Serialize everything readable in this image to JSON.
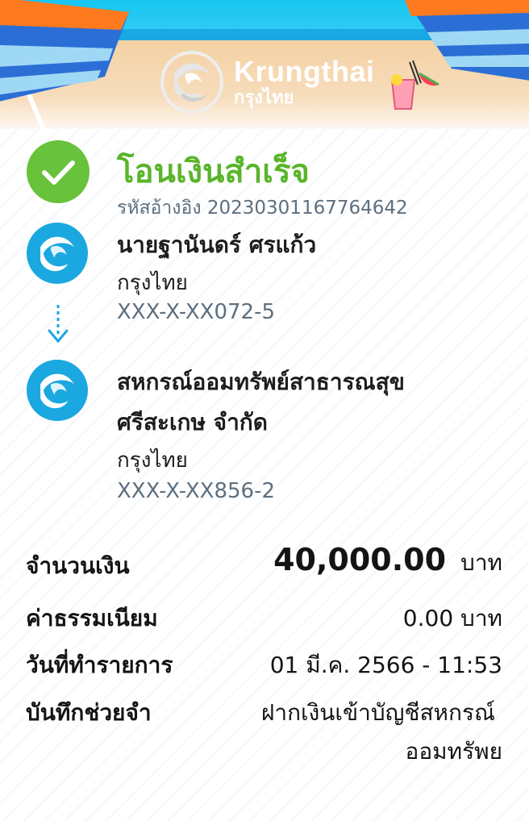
{
  "header": {
    "brand_en": "Krungthai",
    "brand_th": "กรุงไทย"
  },
  "status": {
    "title": "โอนเงินสำเร็จ",
    "reference_label": "รหัสอ้างอิง",
    "reference_number": "20230301167764642",
    "color": "#5ab52a"
  },
  "sender": {
    "name": "นายฐานันดร์ ศรแก้ว",
    "bank": "กรุงไทย",
    "account": "XXX-X-XX072-5"
  },
  "receiver": {
    "name_line1": "สหกรณ์ออมทรัพย์สาธารณสุข",
    "name_line2": "ศรีสะเกษ จำกัด",
    "bank": "กรุงไทย",
    "account": "XXX-X-XX856-2"
  },
  "details": {
    "amount_label": "จำนวนเงิน",
    "amount_value": "40,000.00",
    "amount_unit": "บาท",
    "fee_label": "ค่าธรรมเนียม",
    "fee_value": "0.00 บาท",
    "date_label": "วันที่ทำรายการ",
    "date_value": "01 มี.ค. 2566 - 11:53",
    "memo_label": "บันทึกช่วยจำ",
    "memo_line1": "ฝากเงินเข้าบัญชีสหกรณ์",
    "memo_line2": "ออมทรัพย"
  },
  "colors": {
    "brand_blue": "#1ba8e0",
    "success_green": "#68c23b",
    "muted_text": "#5d6f7e"
  },
  "icons": [
    "check-icon",
    "krungthai-logo-icon",
    "arrow-down-icon",
    "beach-umbrella-icon",
    "drink-icon"
  ]
}
